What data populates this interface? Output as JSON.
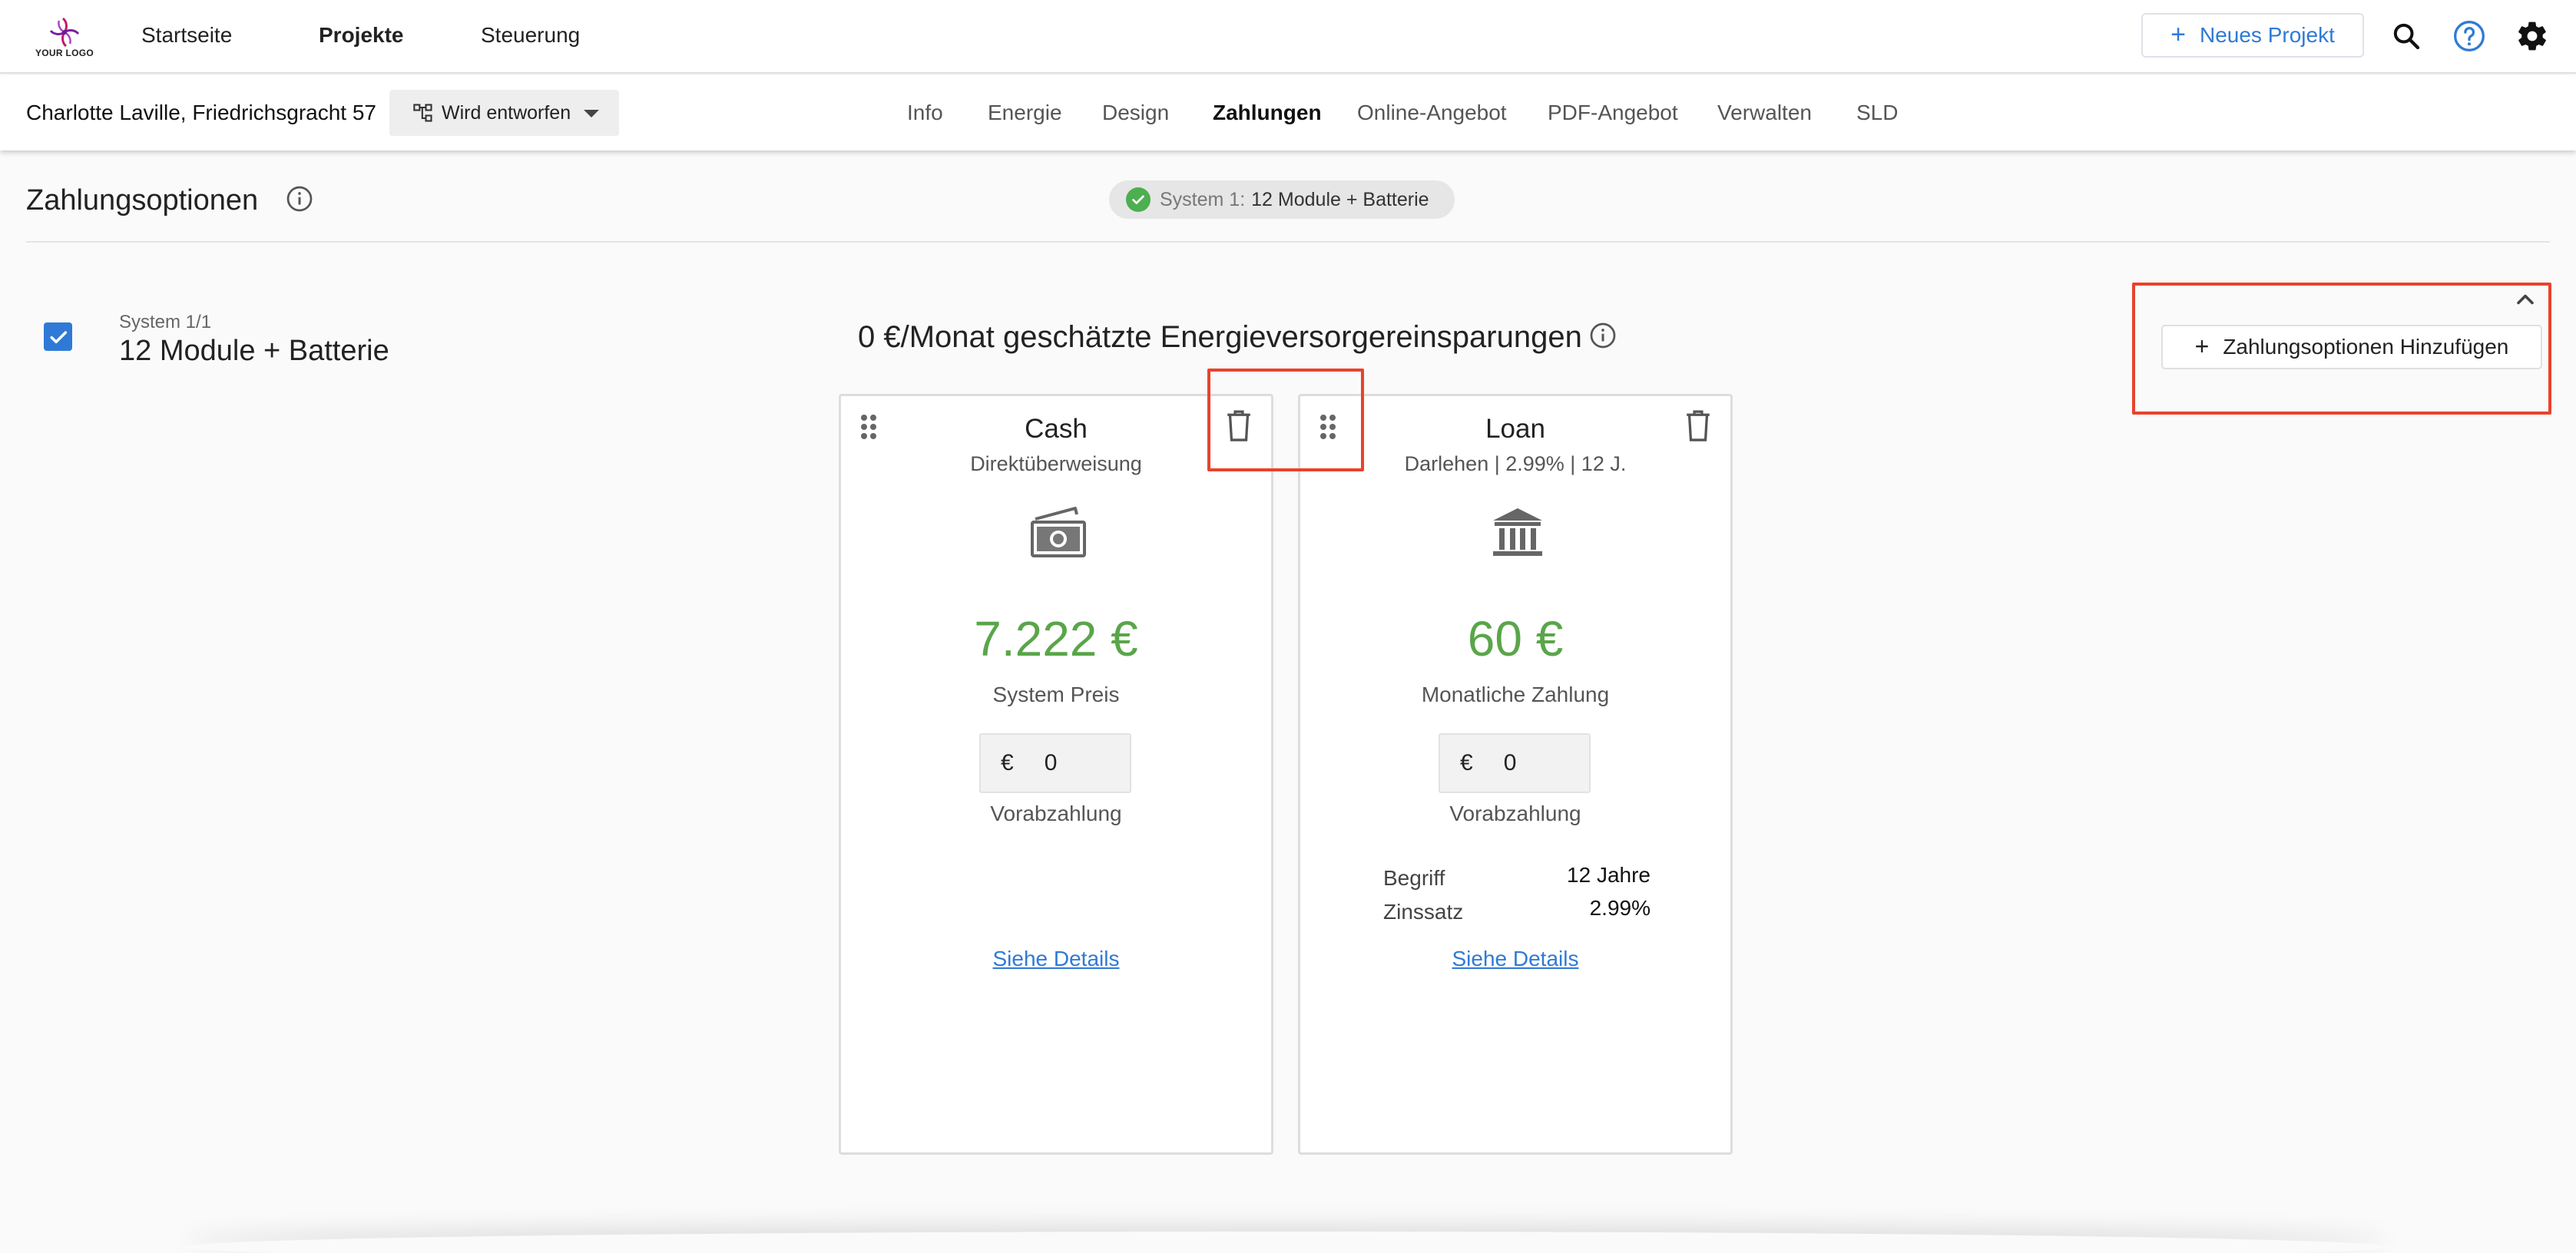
{
  "colors": {
    "accent": "#2f7ad6",
    "amount_green": "#5aa54a",
    "check_green": "#4caf50",
    "highlight_red": "#e8432c"
  },
  "header": {
    "logo_text": "YOUR LOGO",
    "nav": [
      "Startseite",
      "Projekte",
      "Steuerung"
    ],
    "active_nav": "Projekte",
    "new_project_label": "Neues Projekt",
    "icons": [
      "search-icon",
      "help-icon",
      "settings-gear-icon"
    ]
  },
  "project": {
    "name": "Charlotte Laville, Friedrichsgracht 57",
    "status": "Wird entworfen",
    "tabs": [
      "Info",
      "Energie",
      "Design",
      "Zahlungen",
      "Online-Angebot",
      "PDF-Angebot",
      "Verwalten",
      "SLD"
    ],
    "active_tab": "Zahlungen"
  },
  "content": {
    "title": "Zahlungsoptionen",
    "system_pill": {
      "label": "System 1:",
      "value": "12 Module + Batterie"
    },
    "system": {
      "count": "System 1/1",
      "name": "12 Module + Batterie",
      "checked": true,
      "savings": "0 €/Monat geschätzte Energieversorgereinsparungen"
    },
    "add_payment_label": "Zahlungsoptionen Hinzufügen"
  },
  "cards": [
    {
      "title": "Cash",
      "subtitle": "Direktüberweisung",
      "icon": "cash-banknote-icon",
      "amount": "7.222 €",
      "amount_label": "System Preis",
      "currency": "€",
      "down_payment": "0",
      "down_payment_label": "Vorabzahlung",
      "details_link": "Siehe Details"
    },
    {
      "title": "Loan",
      "subtitle": "Darlehen | 2.99% | 12 J.",
      "icon": "bank-building-icon",
      "amount": "60 €",
      "amount_label": "Monatliche Zahlung",
      "currency": "€",
      "down_payment": "0",
      "down_payment_label": "Vorabzahlung",
      "rows": [
        {
          "label": "Begriff",
          "value": "12 Jahre"
        },
        {
          "label": "Zinssatz",
          "value": "2.99%"
        }
      ],
      "details_link": "Siehe Details"
    }
  ]
}
